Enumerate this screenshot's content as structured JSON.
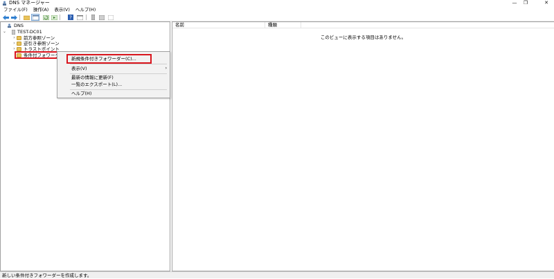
{
  "window": {
    "title": "DNS マネージャー",
    "controls": [
      "—",
      "❐",
      "✕"
    ]
  },
  "menubar": {
    "items": [
      "ファイル(F)",
      "操作(A)",
      "表示(V)",
      "ヘルプ(H)"
    ]
  },
  "tree": {
    "root": "DNS",
    "server": "TEST-DC01",
    "nodes": [
      "前方参照ゾーン",
      "逆引き参照ゾーン",
      "トラストポイント",
      "条件付フォワーダ"
    ]
  },
  "list": {
    "columns": [
      "名前",
      "種類"
    ],
    "empty_message": "このビューに表示する項目はありません。"
  },
  "context_menu": {
    "items": [
      "新規条件付きフォワーダー(C)...",
      "表示(V)",
      "最新の情報に更新(F)",
      "一覧のエクスポート(L)...",
      "ヘルプ(H)"
    ],
    "submenu_arrow": "›"
  },
  "status": {
    "text": "新しい条件付きフォワーダーを作成します。"
  },
  "colors": {
    "highlight": "#d9141c",
    "folder": "#e8c25a"
  }
}
